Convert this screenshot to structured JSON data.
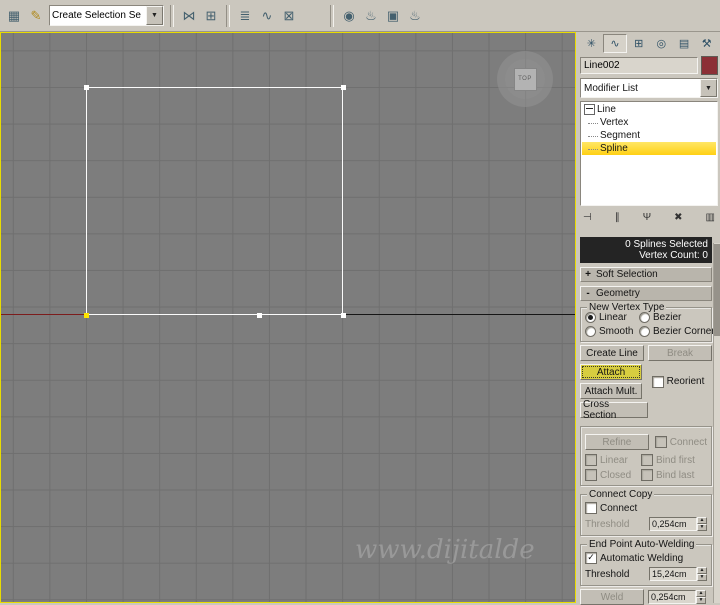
{
  "toolbar": {
    "left_icons": [
      {
        "name": "select-region-icon",
        "glyph": "▦"
      },
      {
        "name": "edit-named-selections-icon",
        "glyph": "✎"
      }
    ],
    "selection_set_value": "Create Selection Se",
    "icons": [
      {
        "name": "mirror-icon",
        "glyph": "⋈"
      },
      {
        "name": "align-icon",
        "glyph": "⊞"
      },
      {
        "name": "layer-manager-icon",
        "glyph": "≣"
      },
      {
        "name": "curve-editor-icon",
        "glyph": "∿"
      },
      {
        "name": "schematic-view-icon",
        "glyph": "⊠"
      },
      {
        "name": "material-editor-icon",
        "glyph": "◉"
      },
      {
        "name": "render-setup-icon",
        "glyph": "♨"
      },
      {
        "name": "rendered-frame-icon",
        "glyph": "▣"
      },
      {
        "name": "render-icon",
        "glyph": "♨"
      }
    ]
  },
  "glyphs": {
    "check": "✓",
    "combo_arrow": "▼",
    "spin_up": "▲",
    "spin_down": "▼",
    "plus": "+",
    "minus": "-",
    "pin": "⊣",
    "end_result": "∥",
    "unique": "Ψ",
    "remove": "✖",
    "configure": "▥"
  },
  "tabs": [
    {
      "name": "create",
      "glyph": "✳"
    },
    {
      "name": "modify",
      "glyph": "∿"
    },
    {
      "name": "hierarchy",
      "glyph": "⊞"
    },
    {
      "name": "motion",
      "glyph": "◎"
    },
    {
      "name": "display",
      "glyph": "▤"
    },
    {
      "name": "utilities",
      "glyph": "⚒"
    }
  ],
  "viewport": {
    "viewcube_label": "TOP",
    "watermark": "www.dijitalde"
  },
  "panel": {
    "object_name": "Line002",
    "modifier_list": "Modifier List",
    "stack": [
      {
        "label": "Line"
      },
      {
        "label": "Vertex"
      },
      {
        "label": "Segment"
      },
      {
        "label": "Spline"
      }
    ],
    "info_line1": "0 Splines Selected",
    "info_line2": "Vertex Count: 0",
    "soft_selection": "Soft Selection",
    "geometry": "Geometry",
    "new_vertex_type": {
      "title": "New Vertex Type",
      "linear": "Linear",
      "bezier": "Bezier",
      "smooth": "Smooth",
      "bezier_corner": "Bezier Corner"
    },
    "buttons": {
      "create_line": "Create Line",
      "break": "Break",
      "attach": "Attach",
      "attach_mult": "Attach Mult.",
      "cross_section": "Cross Section",
      "refine": "Refine",
      "weld": "Weld"
    },
    "checks": {
      "reorient": "Reorient",
      "connect": "Connect",
      "linear": "Linear",
      "bind_first": "Bind first",
      "closed": "Closed",
      "bind_last": "Bind last"
    },
    "connect_copy": {
      "title": "Connect Copy",
      "connect": "Connect",
      "threshold": "Threshold",
      "value": "0,254cm"
    },
    "auto_weld": {
      "title": "End Point Auto-Welding",
      "automatic": "Automatic Welding",
      "threshold": "Threshold",
      "value": "15,24cm"
    },
    "weld_value": "0,254cm"
  }
}
